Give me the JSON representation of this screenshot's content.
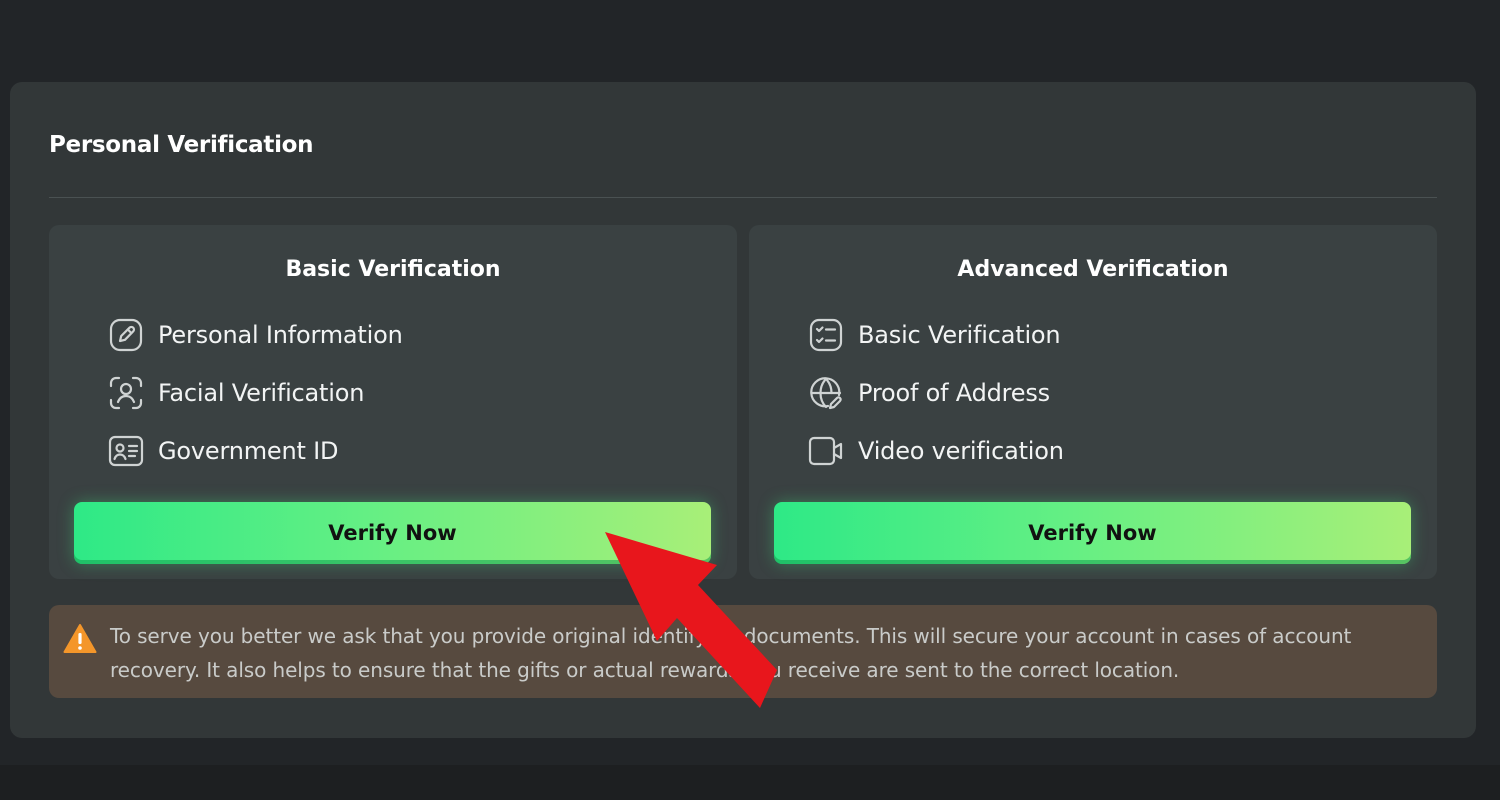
{
  "section": {
    "title": "Personal Verification"
  },
  "basic_card": {
    "title": "Basic Verification",
    "features": [
      {
        "label": "Personal Information",
        "icon": "edit-icon"
      },
      {
        "label": "Facial Verification",
        "icon": "face-scan-icon"
      },
      {
        "label": "Government ID",
        "icon": "id-card-icon"
      }
    ],
    "button_label": "Verify Now"
  },
  "advanced_card": {
    "title": "Advanced Verification",
    "features": [
      {
        "label": "Basic Verification",
        "icon": "checklist-icon"
      },
      {
        "label": "Proof of Address",
        "icon": "globe-icon"
      },
      {
        "label": "Video verification",
        "icon": "video-icon"
      }
    ],
    "button_label": "Verify Now"
  },
  "notice": {
    "icon": "warning-icon",
    "text": "To serve you better we ask that you provide original identifying documents. This will secure your account in cases of account recovery. It also helps to ensure that the gifts or actual rewards you receive are sent to the correct location."
  },
  "colors": {
    "background": "#222528",
    "panel": "#323738",
    "card": "#3a4142",
    "button_gradient_start": "#2ee986",
    "button_gradient_end": "#a8ef78",
    "notice_background": "#574a3f",
    "warning": "#f4962a",
    "annotation_arrow": "#e8161c"
  }
}
